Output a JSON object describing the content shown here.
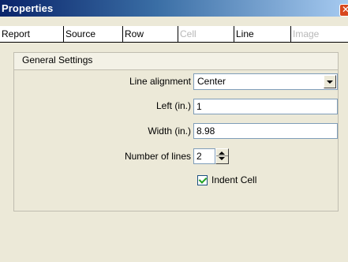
{
  "window": {
    "title": "Properties",
    "close_glyph": "✕"
  },
  "tabs": [
    {
      "label": "Report",
      "enabled": true
    },
    {
      "label": "Source",
      "enabled": true
    },
    {
      "label": "Row",
      "enabled": true
    },
    {
      "label": "Cell",
      "enabled": false
    },
    {
      "label": "Line",
      "enabled": true,
      "selected": true
    },
    {
      "label": "Image",
      "enabled": false
    }
  ],
  "general_settings": {
    "header": "General Settings",
    "line_alignment": {
      "label": "Line alignment",
      "value": "Center"
    },
    "left": {
      "label": "Left (in.)",
      "value": "1"
    },
    "width": {
      "label": "Width (in.)",
      "value": "8.98"
    },
    "number_of_lines": {
      "label": "Number of lines",
      "value": "2"
    },
    "indent_cell": {
      "label": "Indent Cell",
      "checked": true
    }
  },
  "colors": {
    "title_start": "#0a246a",
    "title_end": "#a6caf0",
    "close_button": "#d8481e",
    "dialog_bg": "#ece9d8",
    "check_mark": "#21a121"
  },
  "icons": {
    "dropdown": "chevron-down-icon",
    "spin_up": "arrow-up-icon",
    "spin_down": "arrow-down-icon",
    "checkbox": "check-icon"
  }
}
